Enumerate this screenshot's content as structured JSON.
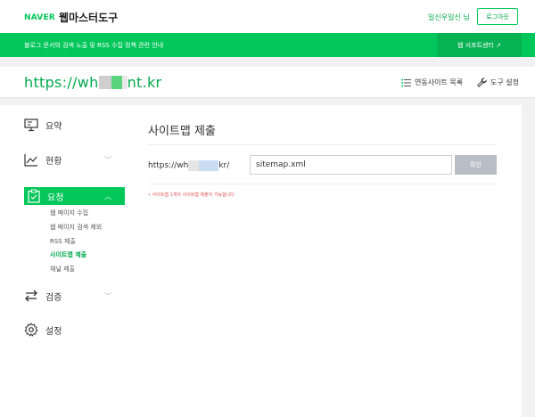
{
  "header": {
    "brand": "NAVER",
    "app_title": "웹마스터도구",
    "user_greeting": "일신우일신 님",
    "logout_label": "로그아웃"
  },
  "banner": {
    "message": "블로그 문서의 검색 노출 및 RSS 수집 정책 관련 안내",
    "support_label": "웹 서포트센터 ↗"
  },
  "site": {
    "url_prefix": "https://wh",
    "url_suffix": "nt.kr",
    "linked_sites_label": "연동사이트 목록",
    "tool_settings_label": "도구 설정"
  },
  "sidebar": {
    "items": [
      {
        "label": "요약"
      },
      {
        "label": "현황",
        "chevron": "﹀"
      },
      {
        "label": "요청",
        "chevron": "︿"
      },
      {
        "label": "검증",
        "chevron": "﹀"
      },
      {
        "label": "설정"
      }
    ],
    "sub_items": [
      {
        "label": "웹 페이지 수집"
      },
      {
        "label": "웹 페이지 검색 제외"
      },
      {
        "label": "RSS 제출"
      },
      {
        "label": "사이트맵 제출"
      },
      {
        "label": "채널 제출"
      }
    ]
  },
  "main": {
    "title": "사이트맵 제출",
    "url_prefix_start": "https://wh",
    "url_prefix_end": "kr/",
    "sitemap_value": "sitemap.xml",
    "confirm_label": "확인",
    "note": "• 사이트맵 1개의 사이트맵 제출이 가능합니다"
  },
  "colors": {
    "accent": "#03c75a",
    "accent_dark": "#03a94d",
    "button_disabled": "#b8bec6",
    "note_red": "#e05050"
  }
}
